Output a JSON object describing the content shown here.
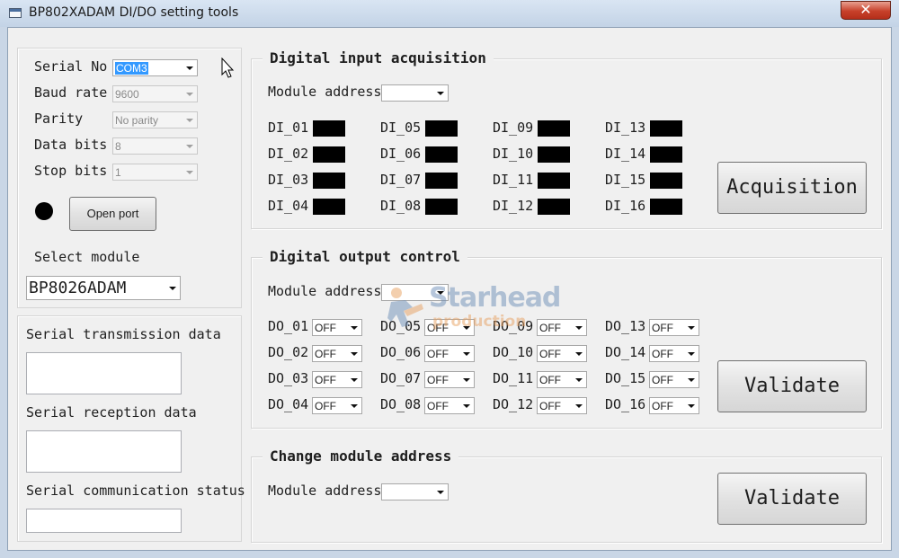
{
  "window": {
    "title": "BP802XADAM DI/DO setting tools",
    "close_glyph": "✕"
  },
  "serial": {
    "serial_no": {
      "label": "Serial No",
      "value": "COM3"
    },
    "baud_rate": {
      "label": "Baud rate",
      "value": "9600"
    },
    "parity": {
      "label": "Parity",
      "value": "No parity"
    },
    "data_bits": {
      "label": "Data bits",
      "value": "8"
    },
    "stop_bits": {
      "label": "Stop bits",
      "value": "1"
    },
    "open_port_label": "Open port",
    "status_led_color": "#000000",
    "select_module_label": "Select module",
    "module_value": "BP8026ADAM"
  },
  "serial_info": {
    "transmission_label": "Serial transmission data",
    "reception_label": "Serial reception data",
    "status_label": "Serial communication status"
  },
  "di_group": {
    "title": "Digital input acquisition",
    "module_address_label": "Module address",
    "module_address_value": "",
    "button_label": "Acquisition",
    "inputs": [
      {
        "label": "DI_01"
      },
      {
        "label": "DI_02"
      },
      {
        "label": "DI_03"
      },
      {
        "label": "DI_04"
      },
      {
        "label": "DI_05"
      },
      {
        "label": "DI_06"
      },
      {
        "label": "DI_07"
      },
      {
        "label": "DI_08"
      },
      {
        "label": "DI_09"
      },
      {
        "label": "DI_10"
      },
      {
        "label": "DI_11"
      },
      {
        "label": "DI_12"
      },
      {
        "label": "DI_13"
      },
      {
        "label": "DI_14"
      },
      {
        "label": "DI_15"
      },
      {
        "label": "DI_16"
      }
    ],
    "indicator_color": "#000000"
  },
  "do_group": {
    "title": "Digital output control",
    "module_address_label": "Module address",
    "module_address_value": "",
    "button_label": "Validate",
    "outputs": [
      {
        "label": "DO_01",
        "value": "OFF"
      },
      {
        "label": "DO_02",
        "value": "OFF"
      },
      {
        "label": "DO_03",
        "value": "OFF"
      },
      {
        "label": "DO_04",
        "value": "OFF"
      },
      {
        "label": "DO_05",
        "value": "OFF"
      },
      {
        "label": "DO_06",
        "value": "OFF"
      },
      {
        "label": "DO_07",
        "value": "OFF"
      },
      {
        "label": "DO_08",
        "value": "OFF"
      },
      {
        "label": "DO_09",
        "value": "OFF"
      },
      {
        "label": "DO_10",
        "value": "OFF"
      },
      {
        "label": "DO_11",
        "value": "OFF"
      },
      {
        "label": "DO_12",
        "value": "OFF"
      },
      {
        "label": "DO_13",
        "value": "OFF"
      },
      {
        "label": "DO_14",
        "value": "OFF"
      },
      {
        "label": "DO_15",
        "value": "OFF"
      },
      {
        "label": "DO_16",
        "value": "OFF"
      }
    ]
  },
  "addr_group": {
    "title": "Change module address",
    "module_address_label": "Module address",
    "module_address_value": "",
    "button_label": "Validate"
  },
  "watermark": {
    "line1": "Starhead",
    "line2": "production"
  }
}
